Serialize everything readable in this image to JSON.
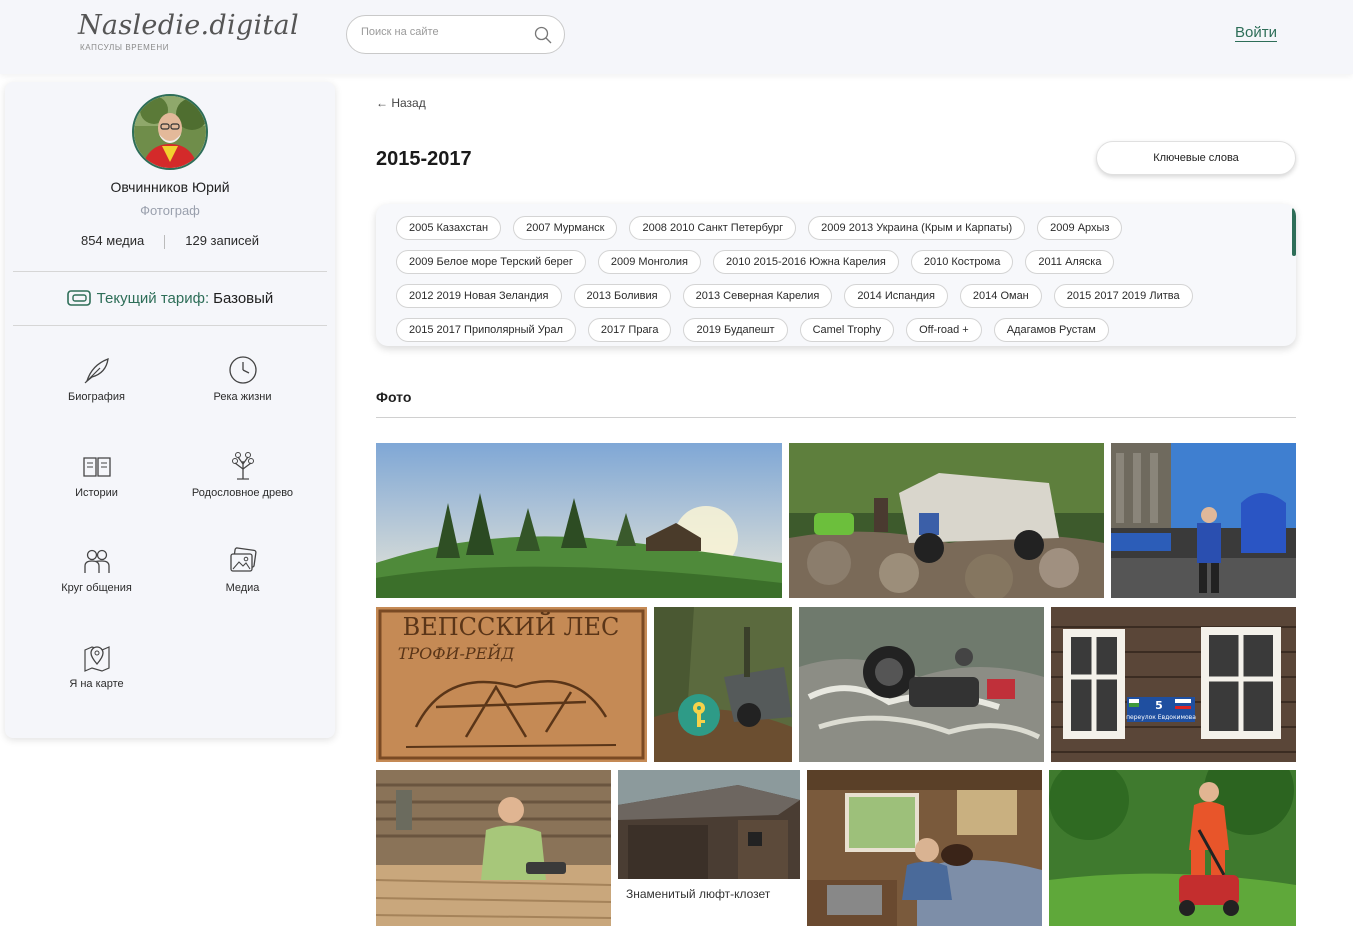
{
  "header": {
    "logo_main": "Nasledie.digital",
    "logo_sub": "КАПСУЛЫ ВРЕМЕНИ",
    "search_placeholder": "Поиск на сайте",
    "login_label": "Войти"
  },
  "profile": {
    "name": "Овчинников Юрий",
    "role": "Фотограф",
    "media_count": "854 медиа",
    "records_count": "129 записей",
    "tariff_label": "Текущий тариф:",
    "tariff_value": "Базовый"
  },
  "menu": [
    {
      "label": "Биография",
      "icon": "feather-icon"
    },
    {
      "label": "Река жизни",
      "icon": "clock-icon"
    },
    {
      "label": "Истории",
      "icon": "book-icon"
    },
    {
      "label": "Родословное древо",
      "icon": "family-tree-icon"
    },
    {
      "label": "Круг общения",
      "icon": "people-icon"
    },
    {
      "label": "Медиа",
      "icon": "photos-icon"
    },
    {
      "label": "Я на карте",
      "icon": "map-pin-icon"
    }
  ],
  "main": {
    "back_label": "← Назад",
    "title": "2015-2017",
    "keywords_button": "Ключевые слова",
    "section_title": "Фото"
  },
  "tags": [
    "2005 Казахстан",
    "2007 Мурманск",
    "2008 2010 Санкт Петербург",
    "2009 2013 Украина (Крым и Карпаты)",
    "2009 Архыз",
    "2009 Белое море Терский берег",
    "2009 Монголия",
    "2010 2015-2016 Южна Карелия",
    "2010 Кострома",
    "2011 Аляска",
    "2012 2019 Новая Зеландия",
    "2013 Боливия",
    "2013 Северная Карелия",
    "2014 Испандия",
    "2014 Оман",
    "2015 2017 2019 Литва",
    "2015 2017 Приполярный Урал",
    "2017 Прага",
    "2019 Будапешт",
    "Camel Trophy",
    "Off-road +",
    "Адагамов Рустам"
  ],
  "photos": {
    "caption_privy": "Знаменитый люфт-клозет",
    "sign_number": "5",
    "sign_street": "переулок Евдокимова",
    "wooden_sign_line1": "ВЕПССКИЙ ЛЕС",
    "wooden_sign_line2": "ТРОФИ-РЕЙД"
  },
  "colors": {
    "accent": "#2e6e58",
    "panel_bg": "#f5f6fa",
    "badge": "#2e9b87"
  }
}
